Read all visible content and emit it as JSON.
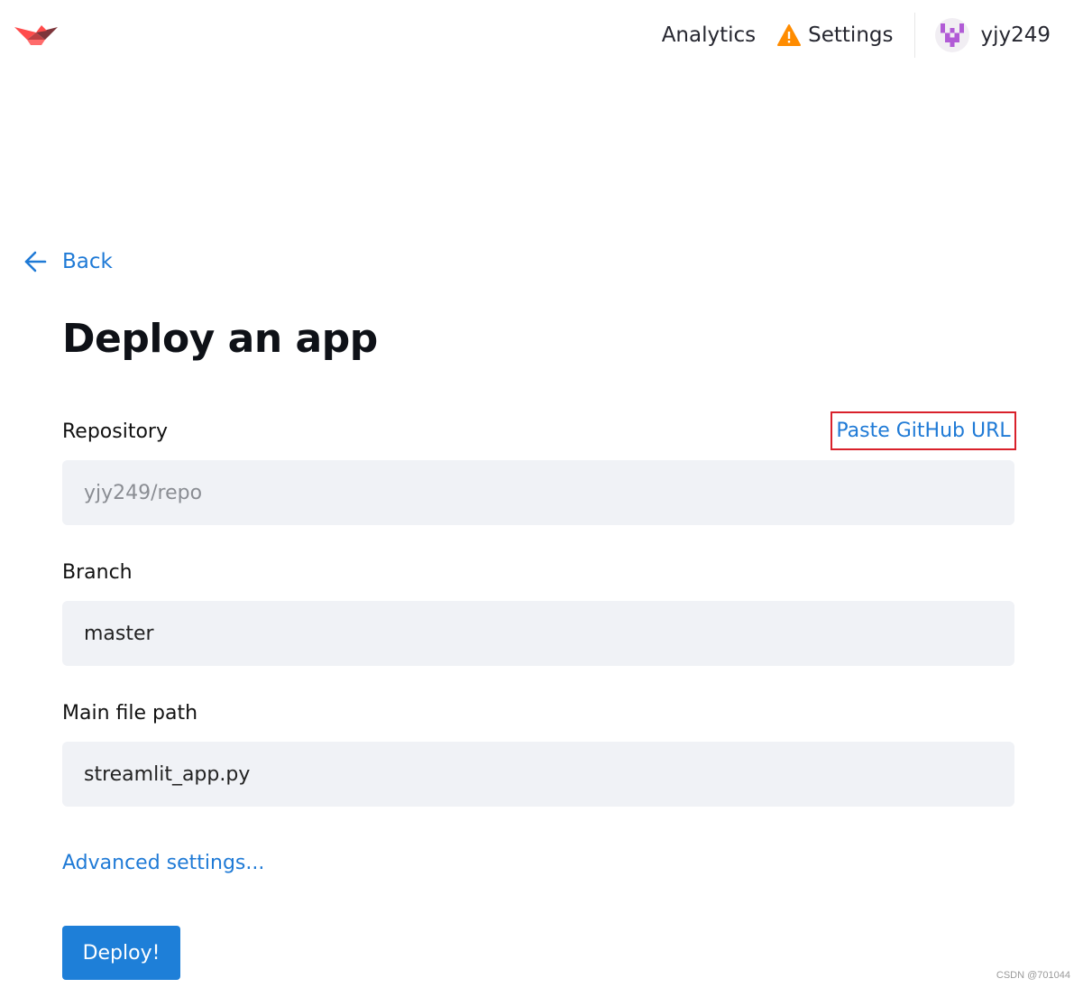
{
  "header": {
    "nav": {
      "analytics_label": "Analytics",
      "settings_label": "Settings",
      "settings_icon": "warning-icon"
    },
    "user": {
      "username": "yjy249"
    },
    "colors": {
      "logo": "#ff4b4b",
      "warning": "#ff8c00",
      "avatar": "#b15bd6"
    }
  },
  "back": {
    "label": "Back"
  },
  "page_title": "Deploy an app",
  "form": {
    "repository": {
      "label": "Repository",
      "placeholder": "yjy249/repo",
      "paste_link_label": "Paste GitHub URL"
    },
    "branch": {
      "label": "Branch",
      "value": "master"
    },
    "main_file": {
      "label": "Main file path",
      "value": "streamlit_app.py"
    },
    "advanced_label": "Advanced settings...",
    "deploy_label": "Deploy!"
  },
  "accent_color": "#1f7ad6",
  "watermark": "CSDN @701044"
}
